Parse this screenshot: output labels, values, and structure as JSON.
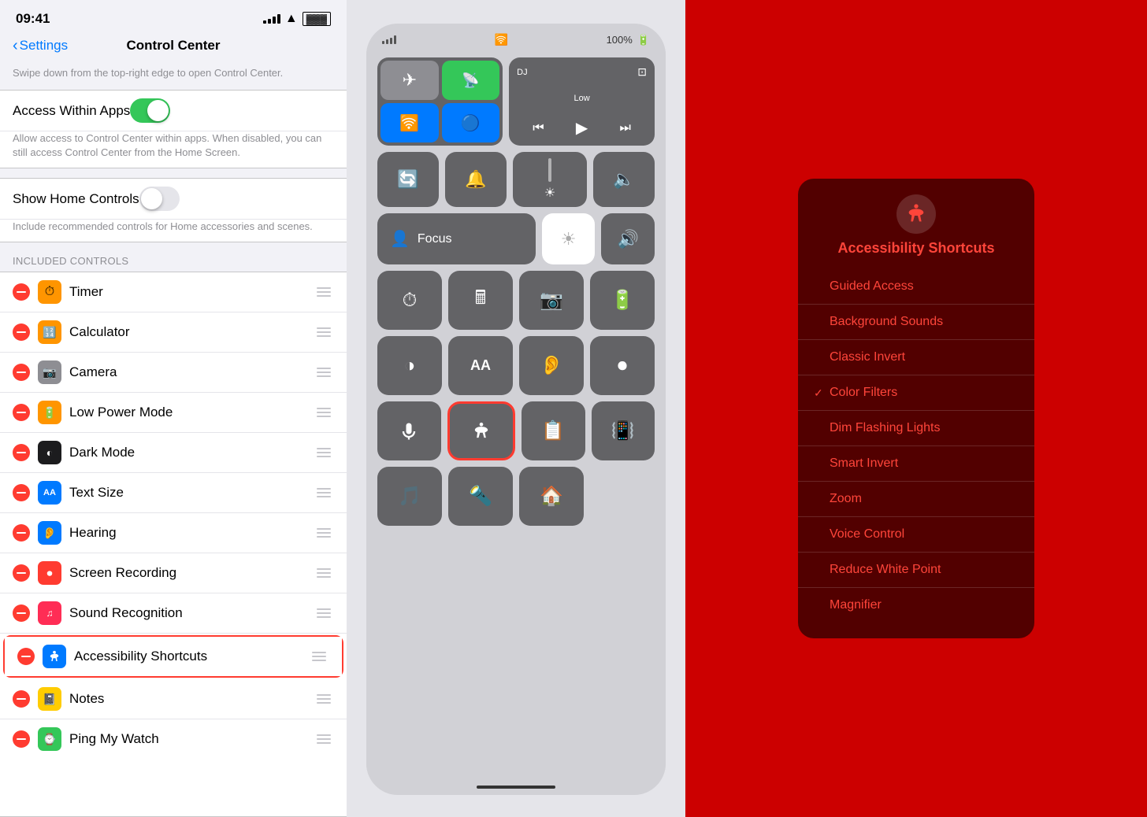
{
  "statusBar": {
    "time": "09:41"
  },
  "navigation": {
    "backLabel": "Settings",
    "title": "Control Center"
  },
  "subtitleText": "Swipe down from the top-right edge to open Control Center.",
  "settings": [
    {
      "id": "access-within-apps",
      "label": "Access Within Apps",
      "sublabel": "Allow access to Control Center within apps. When disabled, you can still access Control Center from the Home Screen.",
      "type": "toggle",
      "value": true
    },
    {
      "id": "show-home-controls",
      "label": "Show Home Controls",
      "sublabel": "Include recommended controls for Home accessories and scenes.",
      "type": "toggle",
      "value": false
    }
  ],
  "includedControlsHeader": "INCLUDED CONTROLS",
  "includedControls": [
    {
      "id": "timer",
      "name": "Timer",
      "iconColor": "#ff9500",
      "iconSymbol": "⏰"
    },
    {
      "id": "calculator",
      "name": "Calculator",
      "iconColor": "#ff9500",
      "iconSymbol": "🔢"
    },
    {
      "id": "camera",
      "name": "Camera",
      "iconColor": "#8e8e93",
      "iconSymbol": "📷"
    },
    {
      "id": "low-power-mode",
      "name": "Low Power Mode",
      "iconColor": "#ff9500",
      "iconSymbol": "🔋"
    },
    {
      "id": "dark-mode",
      "name": "Dark Mode",
      "iconColor": "#1c1c1e",
      "iconSymbol": "●"
    },
    {
      "id": "text-size",
      "name": "Text Size",
      "iconColor": "#007aff",
      "iconSymbol": "AA"
    },
    {
      "id": "hearing",
      "name": "Hearing",
      "iconColor": "#007aff",
      "iconSymbol": "👂"
    },
    {
      "id": "screen-recording",
      "name": "Screen Recording",
      "iconColor": "#ff3b30",
      "iconSymbol": "⏺"
    },
    {
      "id": "sound-recognition",
      "name": "Sound Recognition",
      "iconColor": "#ff2d55",
      "iconSymbol": "🎵"
    },
    {
      "id": "accessibility-shortcuts",
      "name": "Accessibility Shortcuts",
      "iconColor": "#007aff",
      "iconSymbol": "♿",
      "highlighted": true
    },
    {
      "id": "notes",
      "name": "Notes",
      "iconColor": "#ffcc00",
      "iconSymbol": "📓"
    },
    {
      "id": "ping-my-watch",
      "name": "Ping My Watch",
      "iconColor": "#34c759",
      "iconSymbol": "⌚"
    }
  ],
  "accessibilityPopup": {
    "title": "Accessibility Shortcuts",
    "iconSymbol": "♿",
    "items": [
      {
        "id": "guided-access",
        "label": "Guided Access",
        "checked": false
      },
      {
        "id": "background-sounds",
        "label": "Background Sounds",
        "checked": false
      },
      {
        "id": "classic-invert",
        "label": "Classic Invert",
        "checked": false
      },
      {
        "id": "color-filters",
        "label": "Color Filters",
        "checked": true
      },
      {
        "id": "dim-flashing-lights",
        "label": "Dim Flashing Lights",
        "checked": false
      },
      {
        "id": "smart-invert",
        "label": "Smart Invert",
        "checked": false
      },
      {
        "id": "zoom",
        "label": "Zoom",
        "checked": false
      },
      {
        "id": "voice-control",
        "label": "Voice Control",
        "checked": false
      },
      {
        "id": "reduce-white-point",
        "label": "Reduce White Point",
        "checked": false
      },
      {
        "id": "magnifier",
        "label": "Magnifier",
        "checked": false
      }
    ]
  },
  "colors": {
    "accent": "#007aff",
    "destructive": "#ff3b30",
    "green": "#34c759",
    "red": "#cc0000",
    "darkRed": "#cc0000"
  }
}
